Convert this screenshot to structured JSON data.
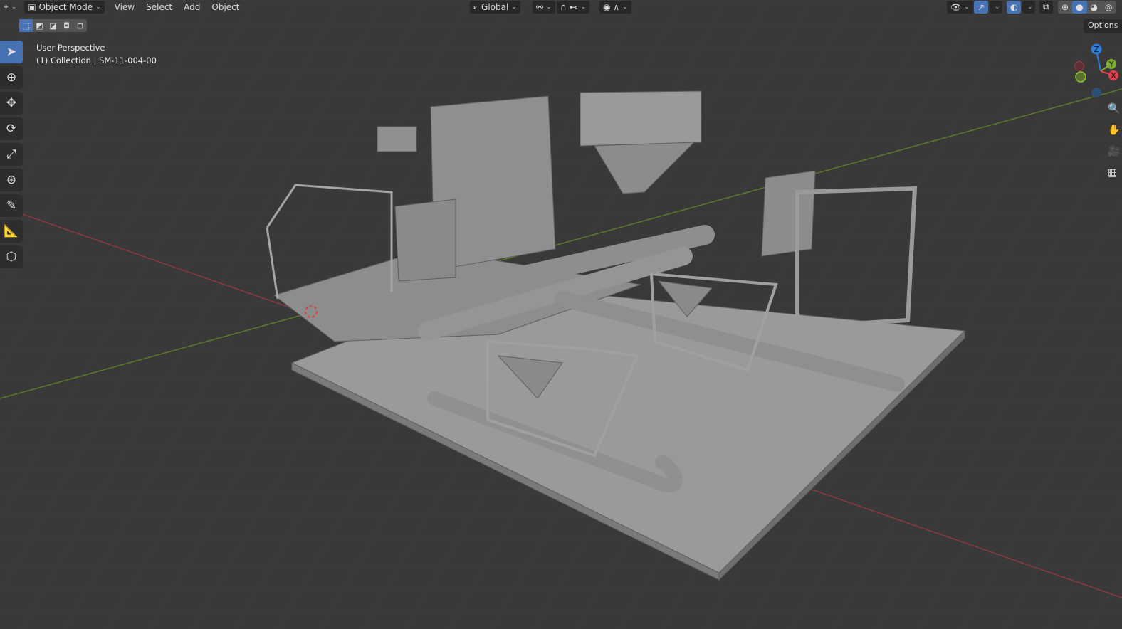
{
  "header": {
    "editor_type_icon": "viewport-icon",
    "mode": "Object Mode",
    "menus": [
      "View",
      "Select",
      "Add",
      "Object"
    ],
    "transform_orientation": "Global",
    "pivot_icon": "pivot-icon",
    "snap_icon": "magnet-icon",
    "proportional_icon": "proportional-icon",
    "overlay_icons": [
      "visibility-icon",
      "gizmo-icon",
      "overlay-icon",
      "xray-icon"
    ],
    "shading_modes": [
      "wireframe",
      "solid",
      "material-preview",
      "rendered"
    ],
    "active_shading": "solid"
  },
  "select_modes": [
    "new",
    "extend",
    "subtract",
    "invert",
    "intersect"
  ],
  "tools": [
    "select-box",
    "cursor",
    "move",
    "rotate",
    "scale",
    "transform",
    "annotate",
    "measure",
    "add-cube"
  ],
  "viewport_info": {
    "line1": "User Perspective",
    "line2": "(1) Collection | SM-11-004-00"
  },
  "options_label": "Options",
  "gizmo": {
    "z": "Z",
    "y": "Y",
    "x": "X"
  },
  "colors": {
    "accent": "#4772b3",
    "x_axis": "#e0404f",
    "y_axis": "#7fae2e",
    "z_axis": "#2f7fdc"
  }
}
